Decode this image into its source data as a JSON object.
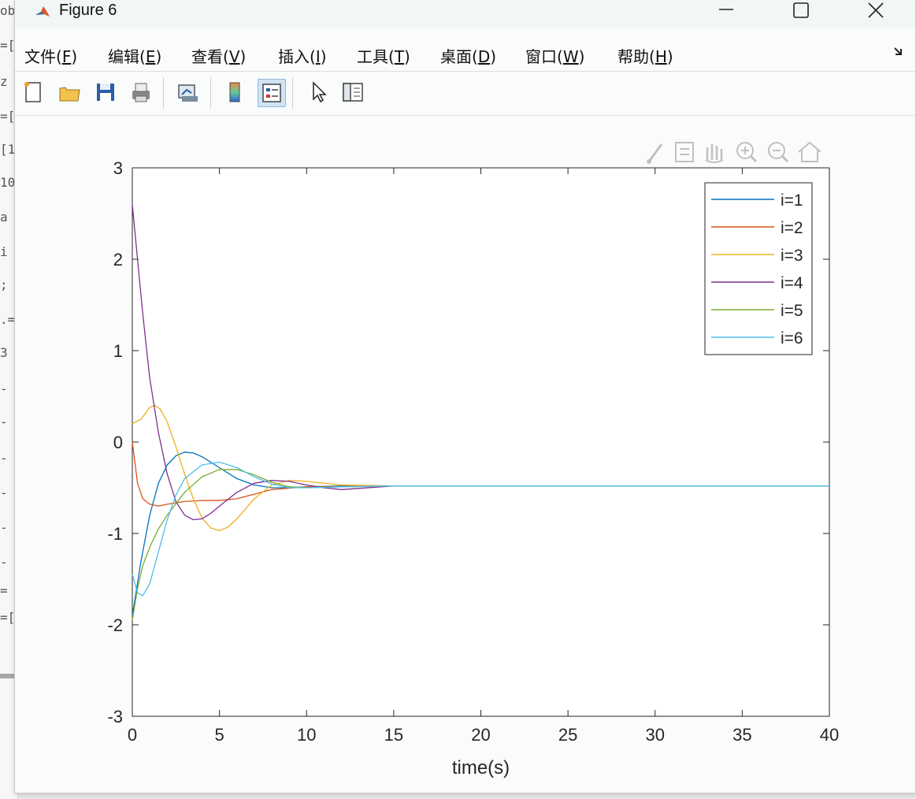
{
  "window": {
    "title": "Figure 6"
  },
  "background_editor": {
    "lines": [
      "ob",
      "=[",
      "z",
      "=[",
      "[1",
      "10",
      "a",
      "i",
      ";",
      ".=",
      "3",
      "-",
      "-",
      "-",
      "-",
      "-",
      "-",
      "=",
      "=["
    ]
  },
  "menu": {
    "items": [
      {
        "label": "文件(",
        "key": "F",
        "tail": ")"
      },
      {
        "label": "编辑(",
        "key": "E",
        "tail": ")"
      },
      {
        "label": "查看(",
        "key": "V",
        "tail": ")"
      },
      {
        "label": "插入(",
        "key": "I",
        "tail": ")"
      },
      {
        "label": "工具(",
        "key": "T",
        "tail": ")"
      },
      {
        "label": "桌面(",
        "key": "D",
        "tail": ")"
      },
      {
        "label": "窗口(",
        "key": "W",
        "tail": ")"
      },
      {
        "label": "帮助(",
        "key": "H",
        "tail": ")"
      }
    ]
  },
  "toolbar": {
    "buttons": [
      "new-figure-icon",
      "open-file-icon",
      "save-icon",
      "print-icon",
      "link-plot-icon",
      "colorbar-icon",
      "legend-icon",
      "pointer-icon",
      "property-inspector-icon"
    ],
    "active": "legend-icon"
  },
  "axes_toolbar": {
    "icons": [
      "brush-icon",
      "data-tips-icon",
      "pan-icon",
      "zoom-in-icon",
      "zoom-out-icon",
      "home-icon"
    ]
  },
  "chart_data": {
    "type": "line",
    "title": "",
    "xlabel": "time(s)",
    "ylabel": "",
    "xlim": [
      0,
      40
    ],
    "ylim": [
      -3,
      3
    ],
    "xticks": [
      0,
      5,
      10,
      15,
      20,
      25,
      30,
      35,
      40
    ],
    "yticks": [
      -3,
      -2,
      -1,
      0,
      1,
      2,
      3
    ],
    "grid": false,
    "legend_position": "top-right",
    "series": [
      {
        "name": "i=1",
        "color": "#0072BD",
        "x": [
          0,
          0.5,
          1,
          1.5,
          2,
          2.5,
          3,
          3.5,
          4,
          5,
          6,
          7,
          8,
          9,
          10,
          12,
          15,
          20,
          25,
          30,
          35,
          40
        ],
        "y": [
          -1.9,
          -1.3,
          -0.8,
          -0.45,
          -0.25,
          -0.15,
          -0.11,
          -0.12,
          -0.16,
          -0.28,
          -0.4,
          -0.47,
          -0.5,
          -0.5,
          -0.49,
          -0.48,
          -0.48,
          -0.48,
          -0.48,
          -0.48,
          -0.48,
          -0.48
        ]
      },
      {
        "name": "i=2",
        "color": "#D95319",
        "x": [
          0,
          0.3,
          0.6,
          1,
          1.5,
          2,
          3,
          4,
          5,
          6,
          7,
          8,
          10,
          15,
          20,
          25,
          30,
          35,
          40
        ],
        "y": [
          0.0,
          -0.45,
          -0.62,
          -0.68,
          -0.7,
          -0.68,
          -0.65,
          -0.64,
          -0.64,
          -0.62,
          -0.57,
          -0.52,
          -0.49,
          -0.48,
          -0.48,
          -0.48,
          -0.48,
          -0.48,
          -0.48
        ]
      },
      {
        "name": "i=3",
        "color": "#EDB120",
        "x": [
          0,
          0.5,
          1,
          1.3,
          1.6,
          2,
          2.5,
          3,
          3.5,
          4,
          4.5,
          5,
          5.5,
          6,
          7,
          8,
          9,
          10,
          12,
          15,
          20,
          25,
          30,
          35,
          40
        ],
        "y": [
          0.2,
          0.25,
          0.38,
          0.4,
          0.36,
          0.22,
          -0.05,
          -0.35,
          -0.62,
          -0.83,
          -0.94,
          -0.97,
          -0.93,
          -0.84,
          -0.62,
          -0.47,
          -0.42,
          -0.43,
          -0.47,
          -0.48,
          -0.48,
          -0.48,
          -0.48,
          -0.48,
          -0.48
        ]
      },
      {
        "name": "i=4",
        "color": "#7E2F8E",
        "x": [
          0,
          0.3,
          0.6,
          1,
          1.5,
          2,
          2.5,
          3,
          3.5,
          4,
          4.5,
          5,
          6,
          7,
          8,
          9,
          10,
          11,
          12,
          15,
          20,
          25,
          30,
          35,
          40
        ],
        "y": [
          2.6,
          2.0,
          1.4,
          0.7,
          0.1,
          -0.35,
          -0.65,
          -0.8,
          -0.85,
          -0.84,
          -0.78,
          -0.7,
          -0.55,
          -0.45,
          -0.42,
          -0.43,
          -0.47,
          -0.5,
          -0.52,
          -0.48,
          -0.48,
          -0.48,
          -0.48,
          -0.48,
          -0.48
        ]
      },
      {
        "name": "i=5",
        "color": "#77AC30",
        "x": [
          0,
          0.3,
          0.6,
          1,
          1.5,
          2,
          3,
          4,
          5,
          6,
          7,
          8,
          9,
          10,
          12,
          15,
          20,
          25,
          30,
          35,
          40
        ],
        "y": [
          -1.95,
          -1.6,
          -1.35,
          -1.15,
          -0.95,
          -0.8,
          -0.55,
          -0.38,
          -0.3,
          -0.3,
          -0.36,
          -0.44,
          -0.49,
          -0.5,
          -0.49,
          -0.48,
          -0.48,
          -0.48,
          -0.48,
          -0.48,
          -0.48
        ]
      },
      {
        "name": "i=6",
        "color": "#4DBEEE",
        "x": [
          0,
          0.3,
          0.6,
          1,
          1.5,
          2,
          2.5,
          3,
          4,
          5,
          6,
          7,
          8,
          9,
          10,
          12,
          15,
          20,
          25,
          30,
          35,
          40
        ],
        "y": [
          -1.45,
          -1.65,
          -1.68,
          -1.55,
          -1.2,
          -0.85,
          -0.58,
          -0.4,
          -0.25,
          -0.22,
          -0.28,
          -0.38,
          -0.46,
          -0.5,
          -0.5,
          -0.49,
          -0.48,
          -0.48,
          -0.48,
          -0.48,
          -0.48,
          -0.48
        ]
      }
    ]
  }
}
